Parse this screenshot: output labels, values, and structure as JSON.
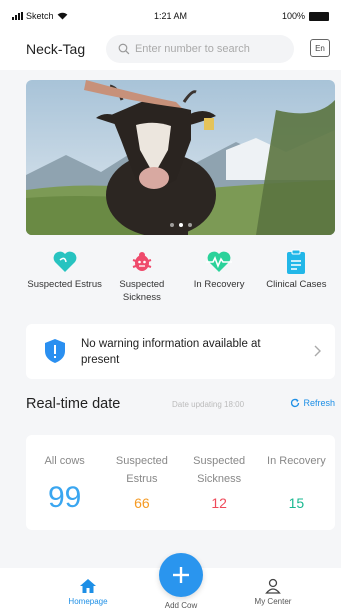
{
  "status_bar": {
    "carrier": "Sketch",
    "time": "1:21 AM",
    "battery": "100%"
  },
  "header": {
    "title": "Neck-Tag",
    "search_placeholder": "Enter number to search",
    "lang_label": "En"
  },
  "banner": {
    "slides": 3,
    "active_slide": 2
  },
  "quick_nav": {
    "items": [
      {
        "label": "Suspected Estrus",
        "icon": "heart-icon",
        "color": "#27c3c0"
      },
      {
        "label": "Suspected Sickness",
        "icon": "bug-icon",
        "color": "#ef4a6c"
      },
      {
        "label": "In Recovery",
        "icon": "heartbeat-icon",
        "color": "#2ad29a"
      },
      {
        "label": "Clinical Cases",
        "icon": "clipboard-icon",
        "color": "#22b7e8"
      }
    ]
  },
  "notice": {
    "text": "No warning information available at present",
    "icon": "shield-alert-icon"
  },
  "realtime": {
    "title": "Real-time date",
    "update_text": "Date updating 18:00",
    "refresh_label": "Refresh"
  },
  "stats": [
    {
      "label": "All cows",
      "value": "99",
      "color": "#3aa6f0"
    },
    {
      "label": "Suspected Estrus",
      "value": "66",
      "color": "#f59a23"
    },
    {
      "label": "Suspected Sickness",
      "value": "12",
      "color": "#ef4a5a"
    },
    {
      "label": "In Recovery",
      "value": "15",
      "color": "#19b890"
    }
  ],
  "tabbar": {
    "items": [
      {
        "label": "Homepage",
        "icon": "home-icon",
        "active": true
      },
      {
        "label": "Add Cow",
        "icon": "plus-icon",
        "active": false
      },
      {
        "label": "My Center",
        "icon": "user-icon",
        "active": false
      }
    ]
  },
  "colors": {
    "accent": "#1d8fe6"
  }
}
